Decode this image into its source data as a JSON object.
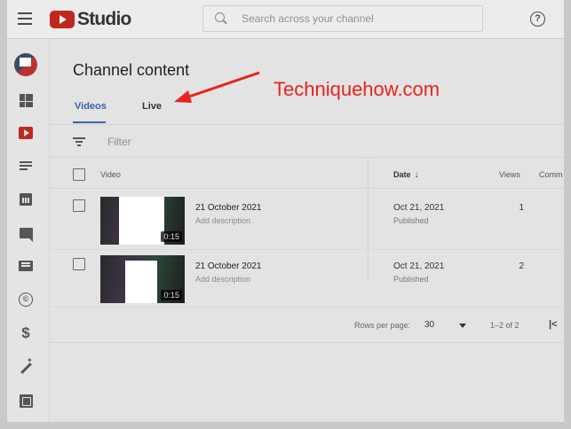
{
  "header": {
    "logo_text": "Studio",
    "search_placeholder": "Search across your channel",
    "help_symbol": "?"
  },
  "sidebar": {
    "icons": [
      "avatar",
      "dashboard-icon",
      "content-icon",
      "playlists-icon",
      "analytics-icon",
      "comments-icon",
      "subtitles-icon",
      "copyright-icon",
      "monetization-icon",
      "customization-icon",
      "audio-library-icon"
    ],
    "dollar_symbol": "$",
    "copyright_symbol": "©"
  },
  "main": {
    "title": "Channel content",
    "tabs": [
      {
        "label": "Videos",
        "active": true
      },
      {
        "label": "Live",
        "active": false
      }
    ],
    "filter_placeholder": "Filter",
    "columns": {
      "video": "Video",
      "date": "Date",
      "date_sort_icon": "↓",
      "views": "Views",
      "comments": "Comm"
    },
    "rows": [
      {
        "title": "21 October 2021",
        "description": "Add description",
        "duration": "0:15",
        "date": "Oct 21, 2021",
        "status": "Published",
        "views": "1"
      },
      {
        "title": "21 October 2021",
        "description": "Add description",
        "duration": "0:15",
        "date": "Oct 21, 2021",
        "status": "Published",
        "views": "2"
      }
    ],
    "pagination": {
      "rows_per_page_label": "Rows per page:",
      "rows_per_page_value": "30",
      "range": "1–2 of 2",
      "first_page_symbol": "|<"
    }
  },
  "annotation": {
    "watermark": "Techniquehow.com",
    "color": "#e8231d"
  },
  "colors": {
    "accent": "#3a63a8",
    "brand_red": "#c0271f"
  }
}
